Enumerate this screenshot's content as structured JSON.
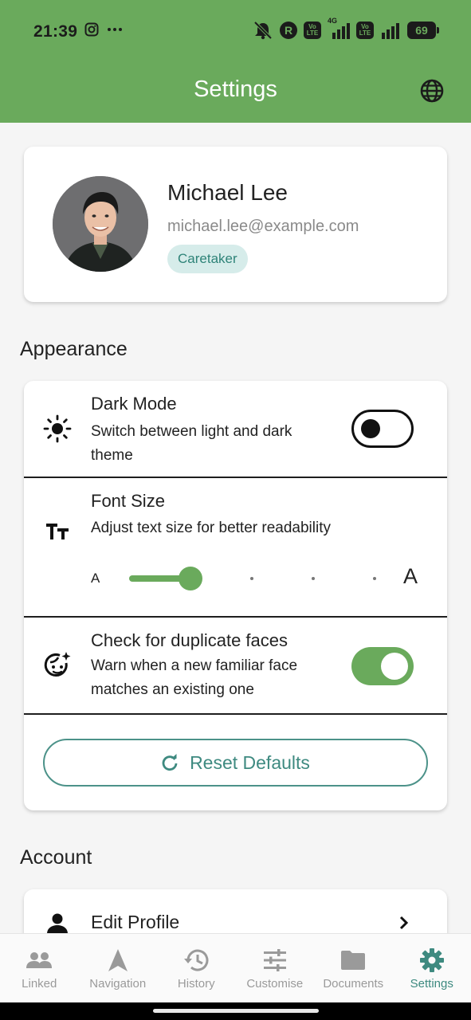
{
  "status_bar": {
    "time": "21:39",
    "battery": "69",
    "volte_label": "Vo LTE",
    "network_label": "4G",
    "r_label": "R"
  },
  "app_bar": {
    "title": "Settings",
    "globe_icon": "globe-icon"
  },
  "profile": {
    "name": "Michael Lee",
    "email": "michael.lee@example.com",
    "role": "Caretaker"
  },
  "appearance": {
    "section_title": "Appearance",
    "dark_mode": {
      "title": "Dark Mode",
      "description": "Switch between light and dark theme",
      "enabled": false,
      "icon": "sun-icon"
    },
    "font_size": {
      "title": "Font Size",
      "description": "Adjust text size for better readability",
      "small_label": "A",
      "large_label": "A",
      "value_fraction": 0.25,
      "steps": 5,
      "icon": "text-size-icon"
    },
    "duplicate_faces": {
      "title": "Check for duplicate faces",
      "description": "Warn when a new familiar face matches an existing one",
      "enabled": true,
      "icon": "face-icon"
    },
    "reset_label": "Reset Defaults"
  },
  "account": {
    "section_title": "Account",
    "items": [
      {
        "label": "Edit Profile",
        "icon": "person-icon"
      }
    ]
  },
  "bottom_nav": [
    {
      "label": "Linked",
      "icon": "people-icon",
      "active": false
    },
    {
      "label": "Navigation",
      "icon": "navigation-icon",
      "active": false
    },
    {
      "label": "History",
      "icon": "history-icon",
      "active": false
    },
    {
      "label": "Customise",
      "icon": "tune-icon",
      "active": false
    },
    {
      "label": "Documents",
      "icon": "folder-icon",
      "active": false
    },
    {
      "label": "Settings",
      "icon": "settings-icon",
      "active": true
    }
  ],
  "colors": {
    "primary": "#6aaa5c",
    "accent": "#3e8a80",
    "badge_bg": "#d6ecea"
  }
}
